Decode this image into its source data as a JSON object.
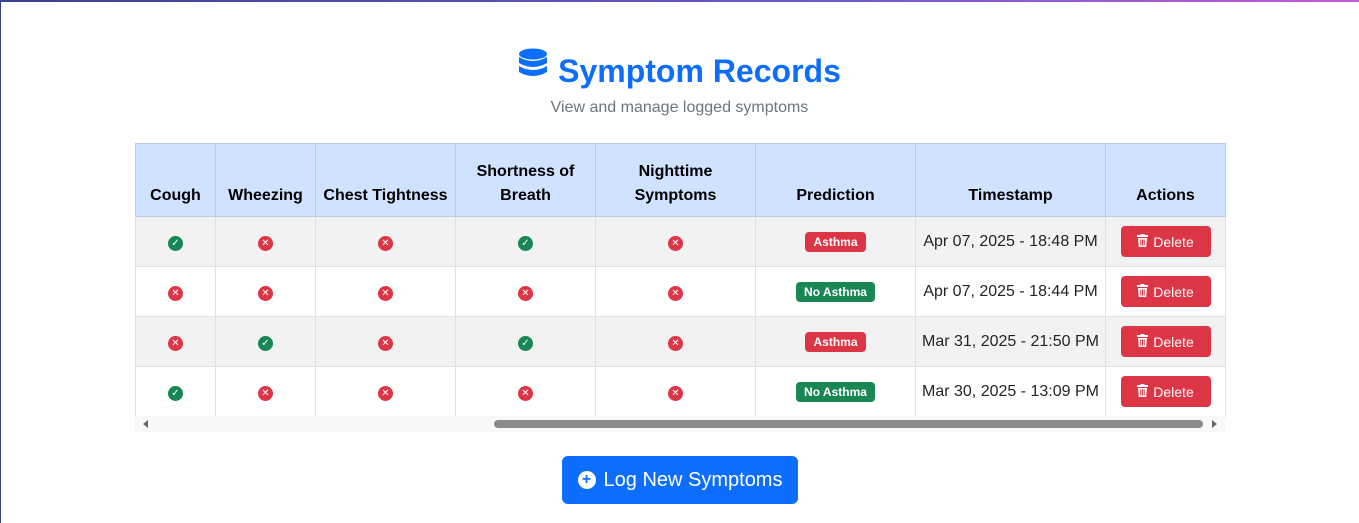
{
  "header": {
    "title": "Symptom Records",
    "subtitle": "View and manage logged symptoms",
    "title_icon": "database-icon"
  },
  "table": {
    "columns": [
      "Cough",
      "Wheezing",
      "Chest Tightness",
      "Shortness of Breath",
      "Nighttime Symptoms",
      "Prediction",
      "Timestamp",
      "Actions"
    ],
    "rows": [
      {
        "cough": true,
        "wheezing": false,
        "chest_tightness": false,
        "shortness_of_breath": true,
        "nighttime_symptoms": false,
        "prediction": "Asthma",
        "timestamp": "Apr 07, 2025 - 18:48 PM",
        "action": "Delete"
      },
      {
        "cough": false,
        "wheezing": false,
        "chest_tightness": false,
        "shortness_of_breath": false,
        "nighttime_symptoms": false,
        "prediction": "No Asthma",
        "timestamp": "Apr 07, 2025 - 18:44 PM",
        "action": "Delete"
      },
      {
        "cough": false,
        "wheezing": true,
        "chest_tightness": false,
        "shortness_of_breath": true,
        "nighttime_symptoms": false,
        "prediction": "Asthma",
        "timestamp": "Mar 31, 2025 - 21:50 PM",
        "action": "Delete"
      },
      {
        "cough": true,
        "wheezing": false,
        "chest_tightness": false,
        "shortness_of_breath": false,
        "nighttime_symptoms": false,
        "prediction": "No Asthma",
        "timestamp": "Mar 30, 2025 - 13:09 PM",
        "action": "Delete"
      }
    ]
  },
  "actions": {
    "log_new_label": "Log New Symptoms"
  },
  "colors": {
    "primary": "#0d6efd",
    "danger": "#dc3545",
    "success": "#198754",
    "header_bg": "#cfe2ff"
  }
}
